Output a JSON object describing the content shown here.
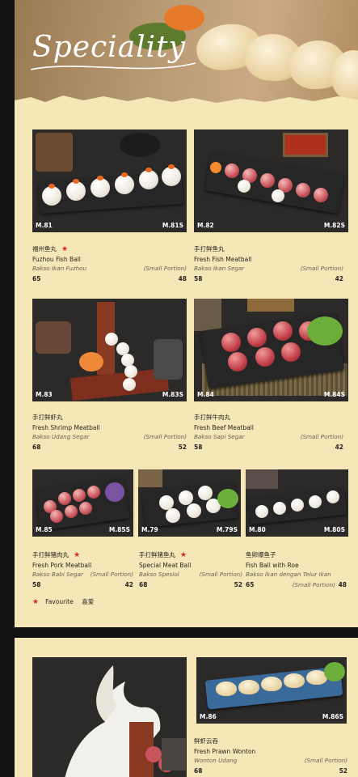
{
  "header": {
    "title": "Speciality"
  },
  "items": [
    {
      "code": "M.81",
      "code_small": "M.81S",
      "name_cn": "福州鱼丸",
      "name_en": "Fuzhou Fish Ball",
      "name_id": "Bakso Ikan Fuzhou",
      "small_label": "(Small Portion)",
      "price": "65",
      "price_small": "48",
      "favourite": true
    },
    {
      "code": "M.82",
      "code_small": "M.82S",
      "name_cn": "手打鲜鱼丸",
      "name_en": "Fresh Fish Meatball",
      "name_id": "Bakso Ikan Segar",
      "small_label": "(Small Portion)",
      "price": "58",
      "price_small": "42",
      "favourite": false
    },
    {
      "code": "M.83",
      "code_small": "M.83S",
      "name_cn": "手打鲜虾丸",
      "name_en": "Fresh Shrimp Meatball",
      "name_id": "Bakso Udang Segar",
      "small_label": "(Small Portion)",
      "price": "68",
      "price_small": "52",
      "favourite": false
    },
    {
      "code": "M.84",
      "code_small": "M.84S",
      "name_cn": "手打鲜牛肉丸",
      "name_en": "Fresh Beef Meatball",
      "name_id": "Bakso Sapi Segar",
      "small_label": "(Small Portion)",
      "price": "58",
      "price_small": "42",
      "favourite": false
    },
    {
      "code": "M.85",
      "code_small": "M.85S",
      "name_cn": "手打鲜猪肉丸",
      "name_en": "Fresh Pork Meatball",
      "name_id": "Bakso Babi Segar",
      "small_label": "(Small Portion)",
      "price": "58",
      "price_small": "42",
      "favourite": true
    },
    {
      "code": "M.79",
      "code_small": "M.79S",
      "name_cn": "手打鲜猪鱼丸",
      "name_en": "Special Meat Ball",
      "name_id": "Bakso Spesiol",
      "small_label": "(Small Portion)",
      "price": "68",
      "price_small": "52",
      "favourite": true
    },
    {
      "code": "M.80",
      "code_small": "M.80S",
      "name_cn": "鱼卵爆鱼子",
      "name_en": "Fish Ball with Roe",
      "name_id": "Bakso Ikan dengan Telur Ikan",
      "small_label": "(Small Portion)",
      "price": "65",
      "price_small": "48",
      "favourite": false
    },
    {
      "code": "M.86",
      "code_small": "M.86S",
      "name_cn": "鲜虾云吞",
      "name_en": "Fresh Prawn Wonton",
      "name_id": "Wonton Udang",
      "small_label": "(Small Portion)",
      "price": "68",
      "price_small": "52",
      "favourite": false
    }
  ],
  "legend": {
    "label": "Favourite",
    "label_cn": "喜爱"
  },
  "colors": {
    "background": "#f5e7b8",
    "accent_star": "#d9261c",
    "text": "#2a2420",
    "photo_bg": "#2c2a29"
  }
}
